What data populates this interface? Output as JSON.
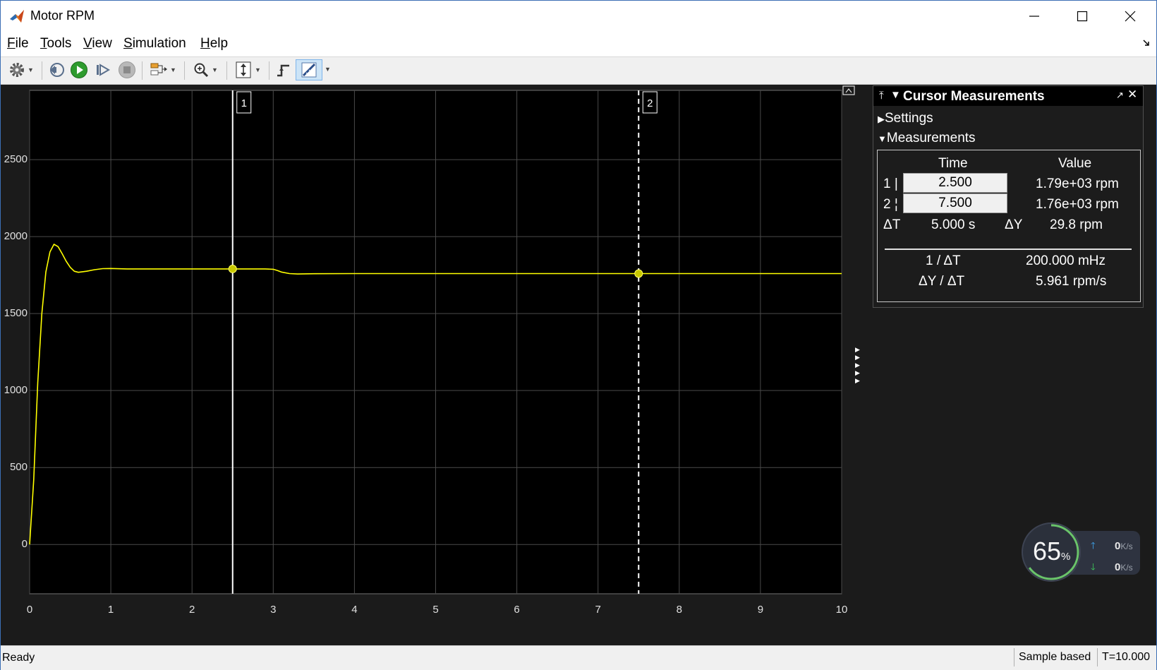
{
  "window": {
    "title": "Motor RPM",
    "controls": {
      "minimize": "─",
      "maximize": "☐",
      "close": "✕"
    }
  },
  "menubar": {
    "items": [
      {
        "underline": "F",
        "rest": "ile"
      },
      {
        "underline": "T",
        "rest": "ools"
      },
      {
        "underline": "V",
        "rest": "iew"
      },
      {
        "underline": "S",
        "rest": "imulation"
      },
      {
        "underline": "H",
        "rest": "elp"
      }
    ]
  },
  "toolbar": {
    "buttons": [
      "settings",
      "step-back",
      "run",
      "step-forward",
      "stop",
      "signal-selection",
      "zoom",
      "autoscale",
      "triggers",
      "cursor-measurements"
    ],
    "active_button": "cursor-measurements"
  },
  "scope": {
    "line_color": "#ffff00",
    "cursor1_label": "1",
    "cursor2_label": "2"
  },
  "chart_data": {
    "type": "line",
    "title": "",
    "xlabel": "",
    "ylabel": "",
    "xlim": [
      0,
      10
    ],
    "ylim": [
      -320,
      2950
    ],
    "x_ticks": [
      "0",
      "1",
      "2",
      "3",
      "4",
      "5",
      "6",
      "7",
      "8",
      "9",
      "10"
    ],
    "y_ticks": [
      "0",
      "500",
      "1000",
      "1500",
      "2000",
      "2500"
    ],
    "grid": true,
    "series": [
      {
        "x": [
          0,
          0.05,
          0.1,
          0.15,
          0.2,
          0.25,
          0.3,
          0.35,
          0.4,
          0.45,
          0.5,
          0.55,
          0.6,
          0.7,
          0.8,
          0.9,
          1.0,
          1.2,
          1.5,
          2.0,
          2.5,
          2.9,
          3.0,
          3.05,
          3.1,
          3.2,
          3.3,
          3.5,
          4.0,
          5.0,
          6.0,
          7.0,
          7.5,
          8.0,
          9.0,
          10.0
        ],
        "y": [
          0,
          420,
          1050,
          1500,
          1770,
          1900,
          1950,
          1935,
          1890,
          1840,
          1800,
          1775,
          1768,
          1775,
          1785,
          1792,
          1793,
          1790,
          1790,
          1790,
          1790,
          1790,
          1788,
          1780,
          1770,
          1760,
          1757,
          1759,
          1760,
          1760,
          1760,
          1760,
          1760,
          1760,
          1760,
          1760
        ]
      }
    ],
    "cursors": [
      {
        "label": "1",
        "time": 2.5,
        "style": "solid"
      },
      {
        "label": "2",
        "time": 7.5,
        "style": "dashed"
      }
    ]
  },
  "cursor_panel": {
    "title": "Cursor Measurements",
    "settings_label": "Settings",
    "measurements_label": "Measurements",
    "col_time": "Time",
    "col_value": "Value",
    "row1_label": "1 |",
    "row1_time": "2.500",
    "row1_value": "1.79e+03 rpm",
    "row2_label": "2 ¦",
    "row2_time": "7.500",
    "row2_value": "1.76e+03 rpm",
    "dt_label": "ΔT",
    "dt_value": "5.000 s",
    "dy_label": "ΔY",
    "dy_value": "29.8 rpm",
    "inv_dt_label": "1 / ΔT",
    "inv_dt_value": "200.000 mHz",
    "dy_dt_label": "ΔY / ΔT",
    "dy_dt_value": "5.961 rpm/s"
  },
  "speed_widget": {
    "percent": "65",
    "percent_unit": "%",
    "percent_value": 65,
    "upload": "0",
    "download": "0",
    "unit": "K/s"
  },
  "statusbar": {
    "status": "Ready",
    "mode": "Sample based",
    "time": "T=10.000"
  }
}
